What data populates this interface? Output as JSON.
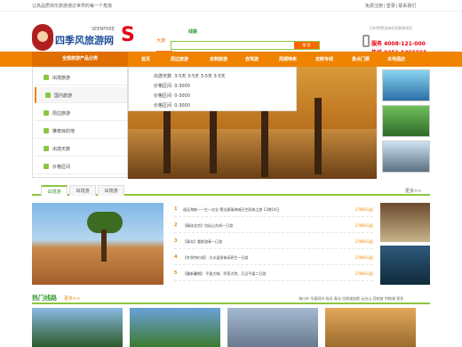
{
  "topbar": {
    "slogan": "让高品质快乐旅游通达世界的每一个角落",
    "links": [
      "免费注册",
      "登录",
      "联系我们"
    ]
  },
  "logo": {
    "name": "四季风旅游网",
    "en": "SEENFREE",
    "s": "S"
  },
  "search": {
    "tab_cat": "大游",
    "tab_line": "线路",
    "button": "搜 索",
    "hot_label": "[ 出游 ]",
    "hot_tag": "热"
  },
  "hotline": {
    "tip": "24H免费咨询在线客服电话",
    "line1": "服务 4008-121-000",
    "line2": "热线 0351-5255555"
  },
  "nav": {
    "category": "全部旅游产品分类",
    "items": [
      "首页",
      "周边旅游",
      "定制旅游",
      "自驾游",
      "周期特卖",
      "定制专线",
      "景点门票",
      "本地酒店"
    ]
  },
  "categories": [
    {
      "label": "出境旅游"
    },
    {
      "label": "国内旅游"
    },
    {
      "label": "周边旅游"
    },
    {
      "label": "推荐目的地"
    },
    {
      "label": "出境天数"
    },
    {
      "label": "价格区间"
    }
  ],
  "popup": {
    "rows": [
      {
        "k": "出游天数",
        "v": "3-5天  3-5天  3-5天  3-5天"
      },
      {
        "k": "价格区间",
        "v": "0-3000"
      },
      {
        "k": "价格区间",
        "v": "0-3000"
      },
      {
        "k": "价格区间",
        "v": "0-3000"
      }
    ]
  },
  "section": {
    "tabs": [
      "出境游",
      "出境游",
      "出境游"
    ],
    "more": "更多>>"
  },
  "routes": [
    {
      "n": "1",
      "title": "遥远海航—一生一次全 德法意瑞海域天空双体之旅 11晚14日",
      "price": "17800元起"
    },
    {
      "n": "2",
      "title": "【精选北京】包括山东线一日游",
      "price": "17800元起"
    },
    {
      "n": "3",
      "title": "【青岛】看鲜游青一日游",
      "price": "17800元起"
    },
    {
      "n": "4",
      "title": "【冬季特价线】 大水温泉休闲养生一日游",
      "price": "17800元起"
    },
    {
      "n": "5",
      "title": "【最新暑期】 平遥古城、乔家大院、又见平遥二日游",
      "price": "17800元起"
    }
  ],
  "hot": {
    "title": "热门线路",
    "more": "更多>>",
    "links": "海口市  华夏网市  临汾  青岛  拉斯维加斯  云台山  西柏坡  利物浦  更多"
  },
  "colors": {
    "accent": "#f08300",
    "green": "#8cc63f",
    "red": "#e60012"
  }
}
